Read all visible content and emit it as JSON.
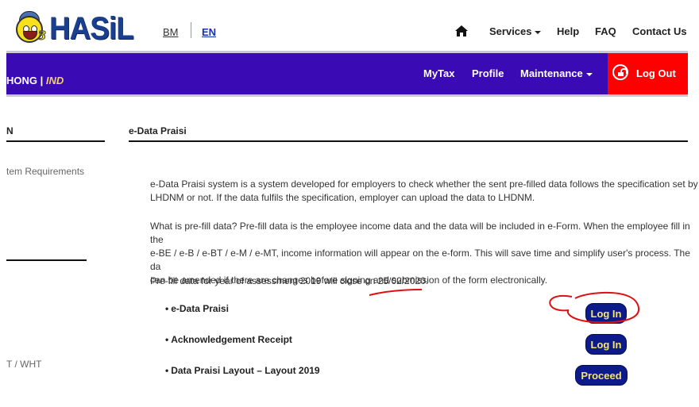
{
  "header": {
    "logo_text": "HASiL",
    "languages": [
      {
        "label": "BM",
        "active": false
      },
      {
        "label": "EN",
        "active": true
      }
    ],
    "top_nav": {
      "home_icon": "home-icon",
      "services": "Services",
      "help": "Help",
      "faq": "FAQ",
      "contact": "Contact Us"
    }
  },
  "main_nav": {
    "user_name": "HONG",
    "separator": "|",
    "user_type": "IND",
    "items": [
      "MyTax",
      "Profile",
      "Maintenance"
    ],
    "logout": "Log Out",
    "colors": {
      "bar": "#3a0ab5",
      "logout": "#ff0000",
      "user_type": "#f4d06a"
    }
  },
  "sidebar": {
    "title": "N",
    "links": [
      "tem Requirements",
      "T / WHT"
    ]
  },
  "content": {
    "section_title": "e-Data Praisi",
    "paragraph1": "e-Data Praisi system is a system developed for employers to check whether the sent pre-filled data follows the specification set by\nLHDNM or not. If the data fulfils the specification, employer can upload the data to LHDNM.",
    "paragraph2": "What is pre-fill data? Pre-fill data is the employee income data and the data will be included in e-Form. When the employee fill in the\ne-BE / e-B / e-BT / e-M / e-MT, income information will appear on the e-form. This will save time and simplify user's process. The da\ncan be amended if there are changes before signing and submission of the form electronically.",
    "paragraph3": "Pre-fill data for year of assessment 2019 will close on 25/02/2020.",
    "items": [
      {
        "label": "e-Data Praisi",
        "button": "Log In"
      },
      {
        "label": "Acknowledgement Receipt",
        "button": "Log In"
      },
      {
        "label": "Data Praisi Layout – Layout 2019",
        "button": "Proceed"
      }
    ],
    "bullet": "•",
    "button_colors": {
      "background": "#0c1a8a",
      "text": "#f5e66a"
    },
    "annotation_color": "#e01010"
  }
}
